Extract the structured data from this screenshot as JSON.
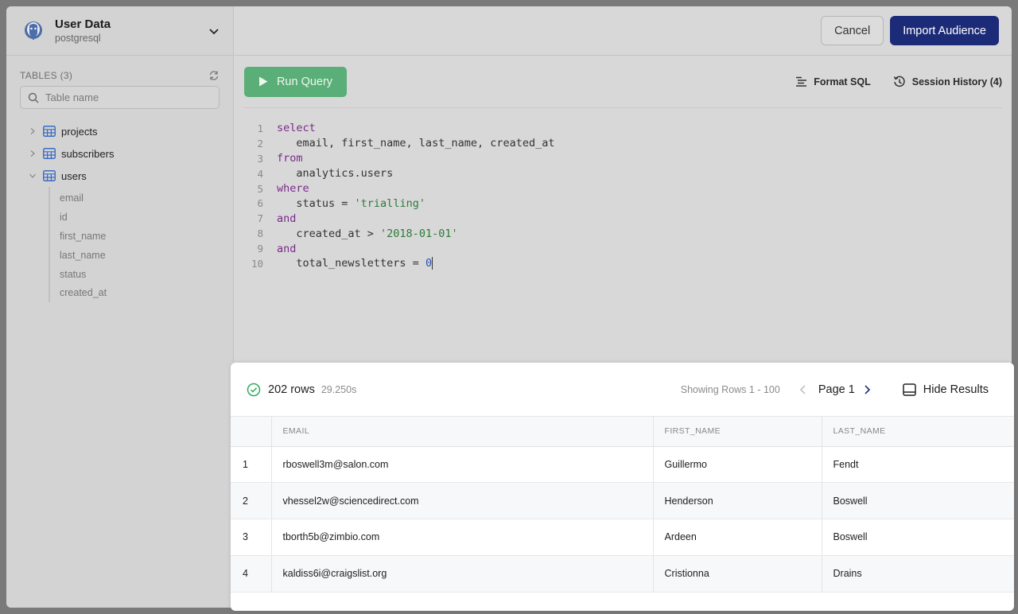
{
  "source": {
    "title": "User Data",
    "subtitle": "postgresql"
  },
  "sidebar": {
    "tables_label": "TABLES (3)",
    "search_placeholder": "Table name",
    "tables": [
      {
        "name": "projects",
        "expanded": false
      },
      {
        "name": "subscribers",
        "expanded": false
      },
      {
        "name": "users",
        "expanded": true
      }
    ],
    "user_columns": [
      "email",
      "id",
      "first_name",
      "last_name",
      "status",
      "created_at"
    ]
  },
  "header": {
    "cancel_label": "Cancel",
    "import_label": "Import Audience"
  },
  "toolbar": {
    "run_label": "Run Query",
    "format_label": "Format SQL",
    "history_label": "Session History (4)"
  },
  "editor": {
    "line_numbers": [
      "1",
      "2",
      "3",
      "4",
      "5",
      "6",
      "7",
      "8",
      "9",
      "10"
    ],
    "l1": "select",
    "l2": "   email, first_name, last_name, created_at",
    "l3": "from",
    "l4": "   analytics.users",
    "l5": "where",
    "l6_a": "   status = ",
    "l6_b": "'trialling'",
    "l7": "and",
    "l8_a": "   created_at > ",
    "l8_b": "'2018-01-01'",
    "l9": "and",
    "l10_a": "   total_newsletters = ",
    "l10_b": "0"
  },
  "results": {
    "rows_count": "202 rows",
    "duration": "29.250s",
    "showing": "Showing Rows 1 - 100",
    "page_label": "Page 1",
    "hide_label": "Hide Results",
    "columns": [
      "EMAIL",
      "FIRST_NAME",
      "LAST_NAME"
    ],
    "rows": [
      {
        "idx": "1",
        "email": "rboswell3m@salon.com",
        "first": "Guillermo",
        "last": "Fendt"
      },
      {
        "idx": "2",
        "email": "vhessel2w@sciencedirect.com",
        "first": "Henderson",
        "last": "Boswell"
      },
      {
        "idx": "3",
        "email": "tborth5b@zimbio.com",
        "first": "Ardeen",
        "last": "Boswell"
      },
      {
        "idx": "4",
        "email": "kaldiss6i@craigslist.org",
        "first": "Cristionna",
        "last": "Drains"
      }
    ]
  },
  "colors": {
    "run": "#5aae77",
    "import": "#1c2b78",
    "success": "#2faa5a"
  }
}
